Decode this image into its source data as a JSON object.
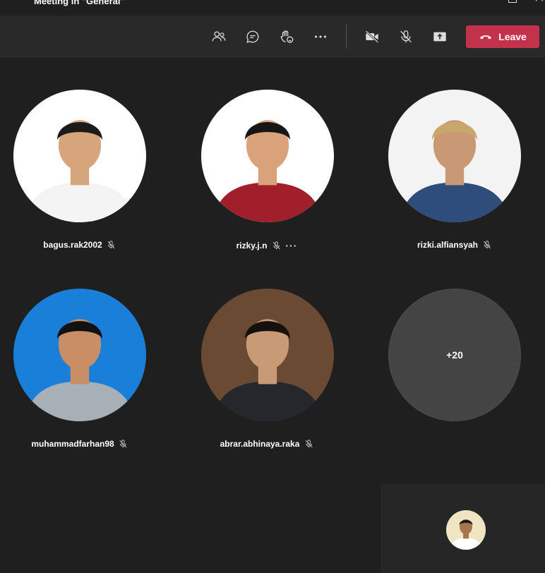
{
  "window": {
    "title": "Meeting in \"General\""
  },
  "toolbar": {
    "leave_label": "Leave"
  },
  "participants": [
    {
      "name": "bagus.rak2002",
      "muted": true,
      "bg": "#ffffff",
      "shirt": "#f4f4f4",
      "skin": "#d7a57c",
      "hair": "#1b1b1b"
    },
    {
      "name": "rizky.j.n",
      "muted": true,
      "bg": "#ffffff",
      "shirt": "#a01f2a",
      "skin": "#d9a27a",
      "hair": "#161616",
      "more": "···"
    },
    {
      "name": "rizki.alfiansyah",
      "muted": true,
      "bg": "#f3f3f3",
      "shirt": "#2e4d7a",
      "skin": "#c99874",
      "hair": "#c9a76b"
    },
    {
      "name": "muhammadfarhan98",
      "muted": true,
      "bg": "#1a7fd8",
      "shirt": "#a7b0b7",
      "skin": "#c98e66",
      "hair": "#111111"
    },
    {
      "name": "abrar.abhinaya.raka",
      "muted": true,
      "bg": "#6b4a34",
      "shirt": "#24272c",
      "skin": "#c99a76",
      "hair": "#15110e"
    }
  ],
  "overflow": {
    "label": "+20"
  },
  "self": {
    "bg": "#efe5c2",
    "shirt": "#ffffff",
    "skin": "#a7764f",
    "hair": "#1a1a1a"
  },
  "icons": [
    "people-icon",
    "chat-icon",
    "raise-hand-icon",
    "more-icon",
    "camera-off-icon",
    "mic-off-icon",
    "share-screen-icon",
    "hang-up-icon",
    "mic-muted-icon"
  ]
}
